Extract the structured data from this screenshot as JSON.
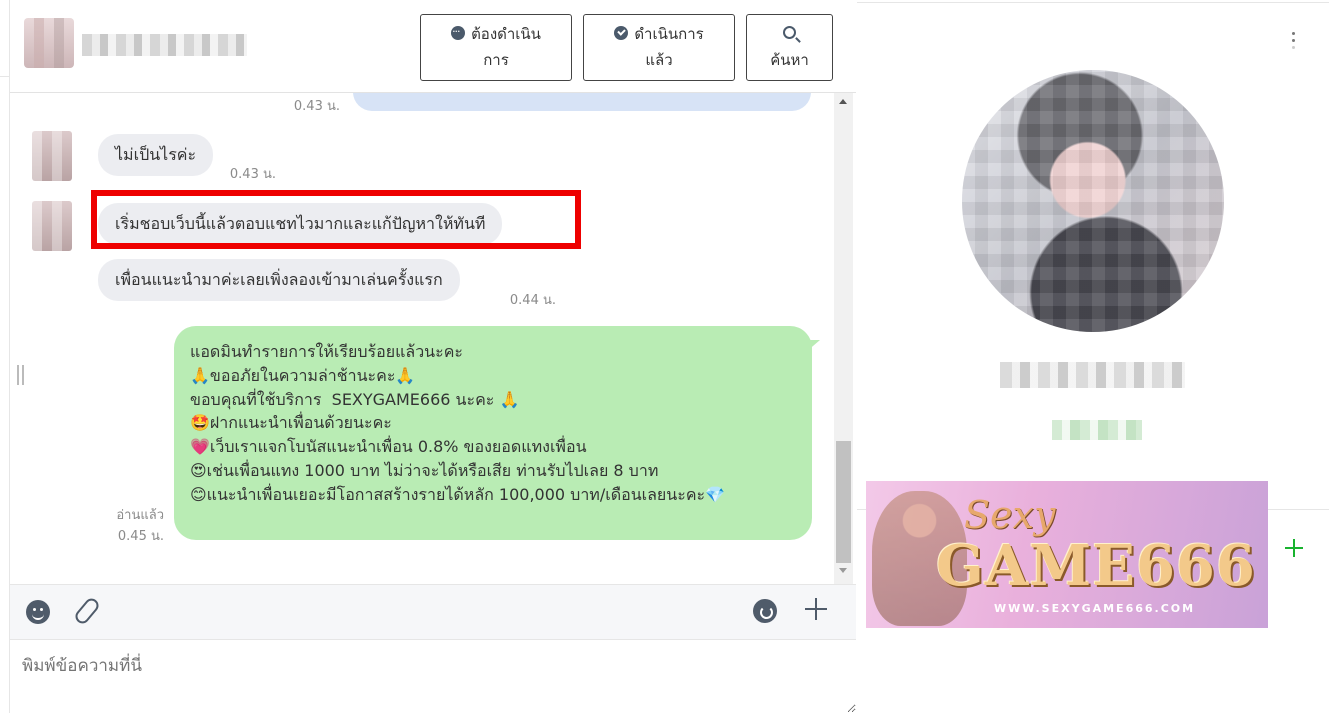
{
  "header": {
    "buttons": {
      "todo": {
        "line1": "ต้องดำเนิน",
        "line2": "การ"
      },
      "done": {
        "line1": "ดำเนินการ",
        "line2": "แล้ว"
      },
      "search": {
        "label": "ค้นหา"
      }
    }
  },
  "messages": [
    {
      "time": "0.43 น."
    },
    {
      "text": "ไม่เป็นไรค่ะ",
      "time": "0.43 น."
    },
    {
      "text": "เริ่มชอบเว็บนี้แล้วตอบแชทไวมากและแก้ปัญหาให้ทันที"
    },
    {
      "text": "เพื่อนแนะนำมาค่ะเลยเพิ่งลองเข้ามาเล่นครั้งแรก",
      "time": "0.44 น."
    }
  ],
  "reply": {
    "read_status": "อ่านแล้ว",
    "time": "0.45 น.",
    "lines": [
      "แอดมินทำรายการให้เรียบร้อยแล้วนะคะ",
      "🙏ขออภัยในความล่าช้านะคะ🙏",
      "ขอบคุณที่ใช้บริการ  SEXYGAME666 นะคะ 🙏",
      "🤩ฝากแนะนำเพื่อนด้วยนะคะ",
      "💗เว็บเราแจกโบนัสแนะนำเพื่อน 0.8% ของยอดแทงเพื่อน",
      "😍เช่นเพื่อนแทง 1000 บาท ไม่ว่าจะได้หรือเสีย ท่านรับไปเลย 8 บาท",
      "😊แนะนำเพื่อนเยอะมีโอกาสสร้างรายได้หลัก 100,000 บาท/เดือนเลยนะคะ💎"
    ]
  },
  "composer": {
    "placeholder": "พิมพ์ข้อความที่นี่"
  },
  "banner": {
    "brand_small": "Sexy",
    "brand_big": "GAME666",
    "url": "WWW.SEXYGAME666.COM"
  },
  "icons": {
    "toolbar": [
      "emoji-icon",
      "attachment-icon",
      "chat-template-icon",
      "plus-icon"
    ],
    "header": [
      "todo-icon",
      "done-icon",
      "search-icon"
    ]
  },
  "colors": {
    "highlight": "#ee0000",
    "reply_bubble": "#b9ecb4",
    "add_plus": "#19b32f"
  }
}
